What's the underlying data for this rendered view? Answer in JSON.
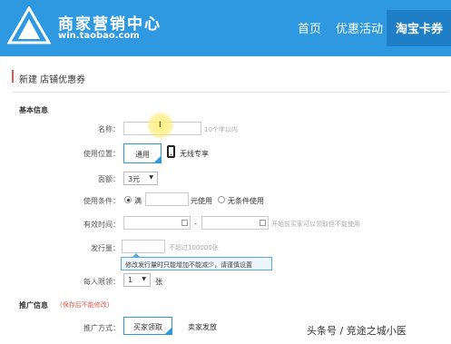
{
  "header": {
    "brand_title": "商家营销中心",
    "brand_url": "win.taobao.com",
    "nav": [
      "首页",
      "优惠活动"
    ],
    "nav_active": "淘宝卡券",
    "colors": {
      "header_bg": "#2e98e0",
      "nav_active_bg": "#1f7fc6",
      "accent_red": "#e05a4f"
    }
  },
  "page": {
    "section_title": "新建 店铺优惠券"
  },
  "basic": {
    "group_title": "基本信息",
    "name": {
      "label": "名称：",
      "value": "",
      "hint": "10个字以内"
    },
    "usage_position": {
      "label": "使用位置：",
      "option": "通用",
      "option2": "无线专享"
    },
    "amount": {
      "label": "面额：",
      "selected": "3元"
    },
    "condition": {
      "label": "使用条件：",
      "radio_full": "满",
      "suffix": "元使用",
      "radio_none": "无条件使用"
    },
    "valid_time": {
      "label": "有效时间：",
      "separator": "-",
      "hint": "开始前买家可以领取但不能使用"
    },
    "issue_count": {
      "label": "发行量：",
      "hint": "不超过100000张"
    },
    "tooltip": "修改发行量时只能增加不能减少，请谨慎设置",
    "per_limit": {
      "label": "每人限领：",
      "selected": "1",
      "unit": "张"
    }
  },
  "promo": {
    "group_title": "推广信息",
    "note": "(保存后不能修改)",
    "method": {
      "label": "推广方式：",
      "option_active": "买家领取",
      "option2": "卖家发放"
    }
  },
  "watermark": "头条号 / 竞途之城小医"
}
